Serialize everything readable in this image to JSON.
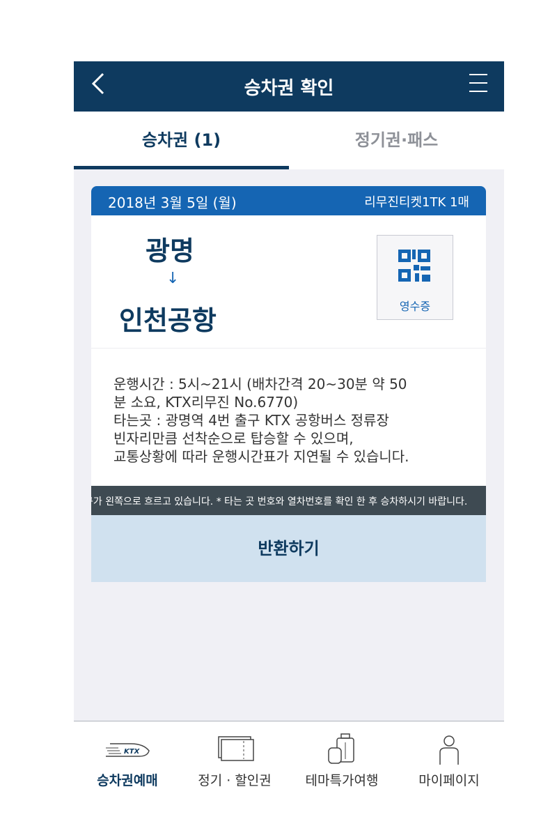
{
  "header": {
    "title": "승차권 확인",
    "back_icon": "chevron-left-icon",
    "menu_icon": "hamburger-menu-icon"
  },
  "tabs": [
    {
      "label": "승차권 (1)",
      "active": true
    },
    {
      "label": "정기권·패스",
      "active": false
    }
  ],
  "ticket": {
    "date": "2018년 3월 5일 (월)",
    "product": "리무진티켓1TK 1매",
    "from": "광명",
    "arrow": "↓",
    "to": "인천공항",
    "receipt_label": "영수증",
    "receipt_icon": "qr-code-icon",
    "info_lines": [
      "운행시간 : 5시~21시 (배차간격 20~30분 약 50",
      "분 소요, KTX리무진 No.6770)",
      "타는곳 : 광명역 4번 출구 KTX 공항버스 정류장",
      "빈자리만큼 선착순으로 탑승할 수 있으며,",
      "교통상황에 따라 운행시간표가 지연될 수 있습니다."
    ],
    "ticker_text": "구가 왼쪽으로 흐르고 있습니다. * 타는 곳 번호와 열차번호를 확인 한 후 승차하시기 바랍니다.",
    "return_label": "반환하기"
  },
  "bottom_nav": [
    {
      "label": "승차권예매",
      "icon": "ktx-train-icon",
      "active": true
    },
    {
      "label": "정기 · 할인권",
      "icon": "ticket-icon",
      "active": false
    },
    {
      "label": "테마특가여행",
      "icon": "luggage-icon",
      "active": false
    },
    {
      "label": "마이페이지",
      "icon": "person-icon",
      "active": false
    }
  ],
  "colors": {
    "header": "#0e3a5f",
    "ticket_top": "#1565b3",
    "return_bg": "#d0e1ef",
    "ticker_bg": "#3e4a52",
    "content_bg": "#f0f0f5"
  }
}
